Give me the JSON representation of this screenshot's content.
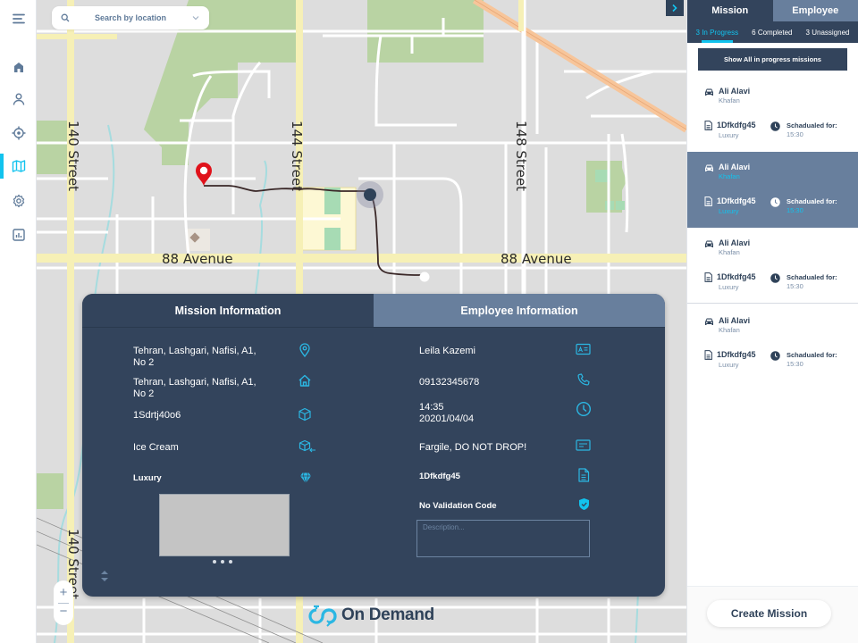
{
  "rail": {
    "items": [
      {
        "name": "menu-icon",
        "label": "menu"
      },
      {
        "name": "home-icon",
        "label": "home"
      },
      {
        "name": "user-icon",
        "label": "users"
      },
      {
        "name": "target-icon",
        "label": "tracking"
      },
      {
        "name": "map-icon",
        "label": "map",
        "active": true
      },
      {
        "name": "gear-icon",
        "label": "settings"
      },
      {
        "name": "report-icon",
        "label": "reports"
      }
    ]
  },
  "map": {
    "search": {
      "placeholder": "Search by location"
    },
    "labels": {
      "street_140": "140 Street",
      "street_144": "144 Street",
      "street_148": "148 Street",
      "avenue_88_left": "88 Avenue",
      "avenue_88_right": "88 Avenue",
      "street_140_bottom": "140 Street"
    },
    "zoom": {
      "in": "+",
      "out": "−"
    },
    "brand": "On Demand",
    "colors": {
      "route": "#3a2828",
      "pin": "#e0121b",
      "driver": "#2f4259"
    }
  },
  "card": {
    "tabs": [
      {
        "label": "Mission Information",
        "active": true
      },
      {
        "label": "Employee Information",
        "active": false
      }
    ],
    "mission": {
      "origin": "Tehran, Lashgari, Nafisi, A1, No 2",
      "destination": "Tehran, Lashgari, Nafisi, A1, No 2",
      "package_id": "1Sdrtj40o6",
      "package_type": "Ice Cream",
      "class": "Luxury"
    },
    "employee": {
      "name": "Leila Kazemi",
      "phone": "09132345678",
      "time": "14:35",
      "date": "20201/04/04",
      "note": "Fargile, DO NOT DROP!",
      "doc_id": "1Dfkdfg45",
      "validation": "No Validation Code",
      "description_placeholder": "Description..."
    }
  },
  "panel": {
    "tabs": [
      {
        "label": "Mission",
        "active": true
      },
      {
        "label": "Employee",
        "active": false
      }
    ],
    "subtabs": [
      {
        "label": "3 In Progress",
        "active": true
      },
      {
        "label": "6 Completed",
        "active": false
      },
      {
        "label": "3 Unassigned",
        "active": false
      }
    ],
    "show_all": "Show All in progress missions",
    "missions": [
      {
        "driver": "Ali Alavi",
        "area": "Khafan",
        "code": "1Dfkdfg45",
        "class": "Luxury",
        "scheduled_label": "Schadualed for:",
        "time": "15:30",
        "selected": false
      },
      {
        "driver": "Ali Alavi",
        "area": "Khafan",
        "code": "1Dfkdfg45",
        "class": "Luxury",
        "scheduled_label": "Schadualed for:",
        "time": "15:30",
        "selected": true
      },
      {
        "driver": "Ali Alavi",
        "area": "Khafan",
        "code": "1Dfkdfg45",
        "class": "Luxury",
        "scheduled_label": "Schadualed for:",
        "time": "15:30",
        "selected": false
      },
      {
        "driver": "Ali Alavi",
        "area": "Khafan",
        "code": "1Dfkdfg45",
        "class": "Luxury",
        "scheduled_label": "Schadualed for:",
        "time": "15:30",
        "selected": false
      }
    ],
    "create_label": "Create Mission"
  },
  "colors": {
    "accent": "#12c3ee",
    "navy": "#33445c",
    "slate": "#687f9d"
  }
}
